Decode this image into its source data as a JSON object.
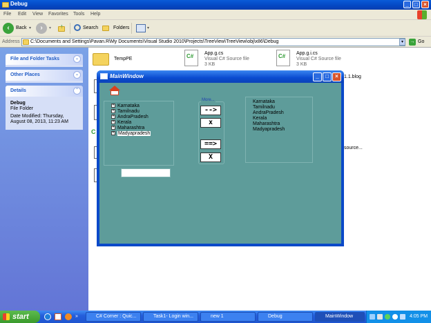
{
  "explorer": {
    "title": "Debug",
    "menu": [
      "File",
      "Edit",
      "View",
      "Favorites",
      "Tools",
      "Help"
    ],
    "toolbar": {
      "back": "Back",
      "search": "Search",
      "folders": "Folders"
    },
    "address_label": "Address",
    "address_value": "C:\\Documents and Settings\\Pavan.R\\My Documents\\Visual Studio 2010\\Projects\\TreeView\\TreeView\\obj\\x86\\Debug",
    "go_label": "Go",
    "tasks": [
      {
        "label": "File and Folder Tasks"
      },
      {
        "label": "Other Places"
      },
      {
        "label": "Details"
      }
    ],
    "details": {
      "name": "Debug",
      "type": "File Folder",
      "modified_line1": "Date Modified: Thursday,",
      "modified_line2": "August 08, 2013, 11:23 AM"
    },
    "files": [
      {
        "name": "TempPE",
        "type": "",
        "size": ""
      },
      {
        "name": "App.g.cs",
        "type": "Visual C# Source file",
        "size": "3 KB"
      },
      {
        "name": "App.g.i.cs",
        "type": "Visual C# Source file",
        "size": "3 KB"
      }
    ],
    "partial_labels": {
      "blog": "1.1.blog",
      "source": "source..."
    }
  },
  "main_window": {
    "title": "MainWindow",
    "tree_items": [
      "Karnataka",
      "Tamilnadu",
      "AndraPradesh",
      "Kerala",
      "Maharashtra",
      "Madyapradesh"
    ],
    "group_label": "More...",
    "buttons": {
      "move_one": "-->",
      "remove_one": "x",
      "move_all": "==>",
      "remove_all": "X"
    },
    "list_items": [
      "Karnataka",
      "Tamilnadu",
      "AndraPradesh",
      "Kerala",
      "Maharashtra",
      "Madyapradesh"
    ]
  },
  "taskbar": {
    "start": "start",
    "buttons": [
      {
        "label": "C# Corner : Quic..."
      },
      {
        "label": "Task1- Login win..."
      },
      {
        "label": "new 1"
      },
      {
        "label": "Debug"
      },
      {
        "label": "MainWindow"
      }
    ],
    "clock": "4:05 PM"
  },
  "colors": {
    "xp_blue": "#0a49c9",
    "window_body": "#5e9c9a",
    "start_green": "#3a9a2c"
  }
}
